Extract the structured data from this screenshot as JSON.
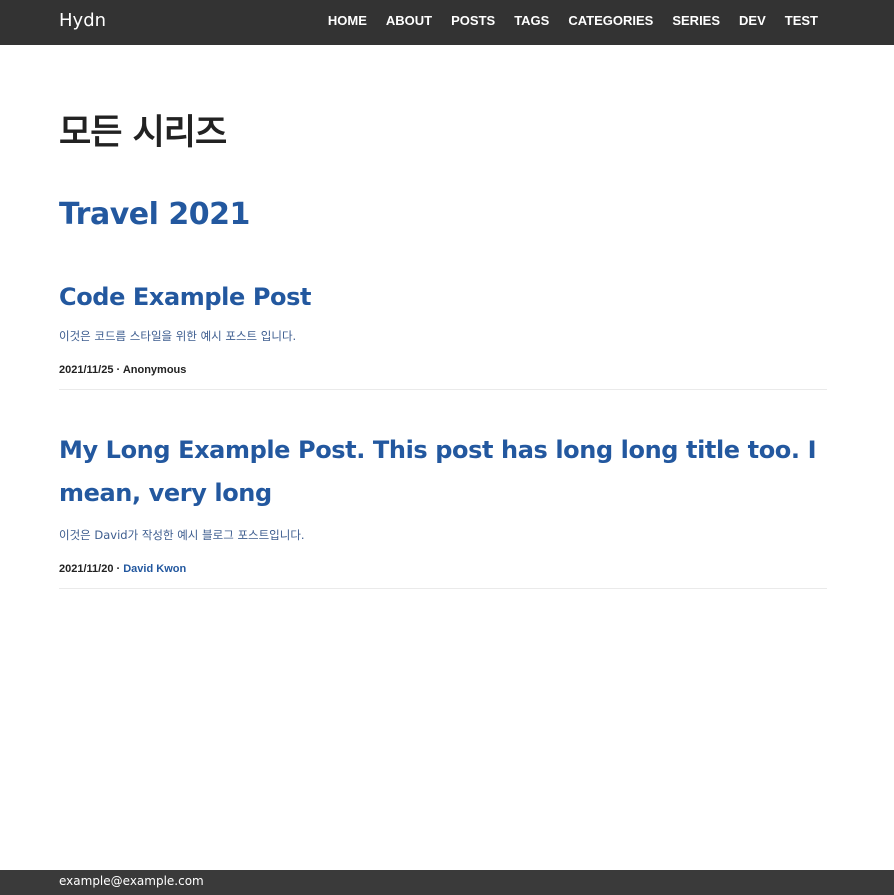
{
  "header": {
    "brand": "Hydn",
    "nav": [
      "HOME",
      "ABOUT",
      "POSTS",
      "TAGS",
      "CATEGORIES",
      "SERIES",
      "DEV",
      "TEST"
    ]
  },
  "main": {
    "page_title": "모든 시리즈",
    "series": [
      {
        "title": "Travel 2021",
        "posts": [
          {
            "title": "Code Example Post",
            "description": "이것은 코드름 스타일을 위한 예시 포스트 입니다.",
            "date": "2021/11/25",
            "separator": " · ",
            "author": "Anonymous"
          },
          {
            "title": "My Long Example Post. This post has long long title too. I mean, very long",
            "description": "이것은 David가 작성한 예시 블로그 포스트입니다.",
            "date": "2021/11/20",
            "separator": " · ",
            "author": "David Kwon"
          }
        ]
      }
    ]
  },
  "footer": {
    "email": "example@example.com"
  },
  "colors": {
    "navbar_bg": "#333333",
    "link_blue": "#23589f",
    "footer_bg": "#3a3a3a"
  }
}
